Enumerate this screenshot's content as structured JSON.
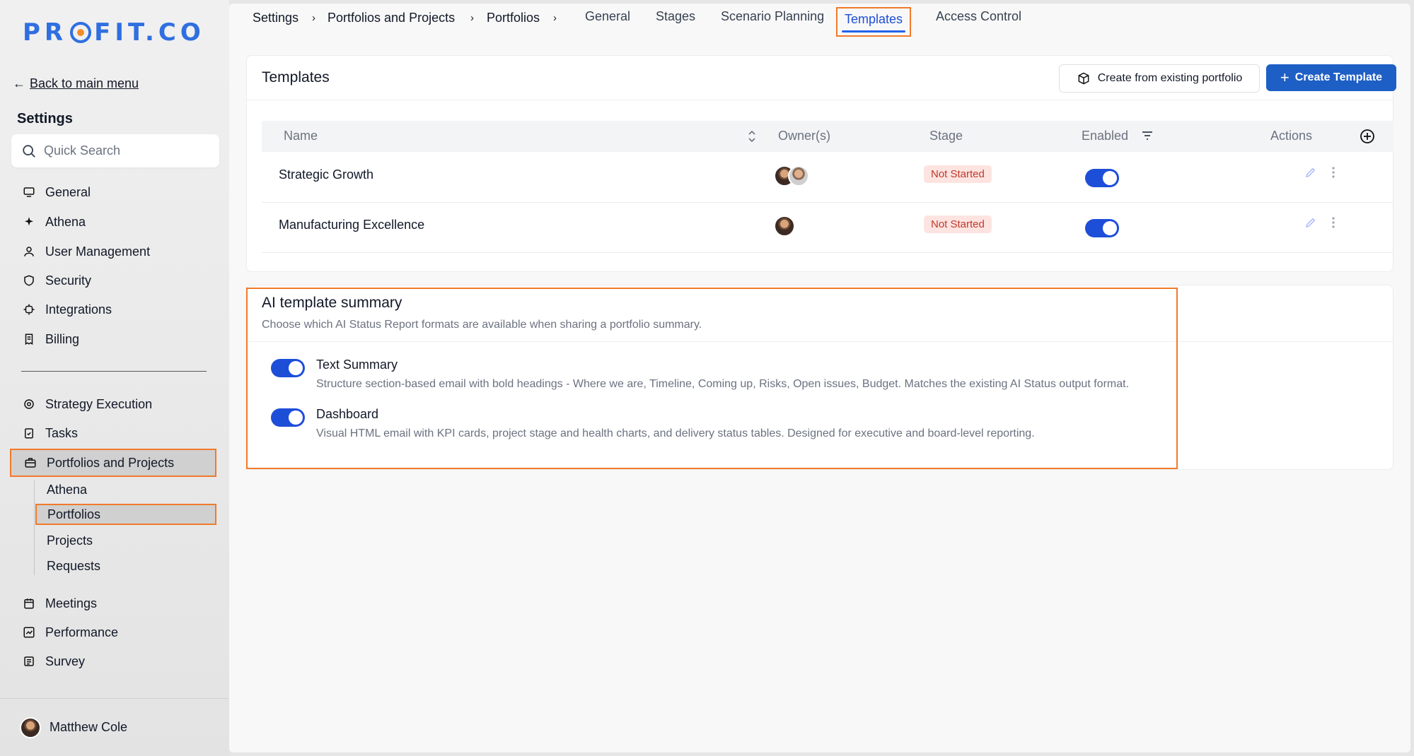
{
  "brand": {
    "logo": "PROFIT.CO",
    "accent": "#1e5fc5",
    "highlight": "#f07a2c"
  },
  "sidebar": {
    "back_label": "Back to main menu",
    "settings_title": "Settings",
    "search_placeholder": "Quick Search",
    "items_top": [
      {
        "label": "General",
        "icon": "monitor-icon"
      },
      {
        "label": "Athena",
        "icon": "sparkle-icon"
      },
      {
        "label": "User Management",
        "icon": "user-icon"
      },
      {
        "label": "Security",
        "icon": "shield-icon"
      },
      {
        "label": "Integrations",
        "icon": "plug-icon"
      },
      {
        "label": "Billing",
        "icon": "receipt-icon"
      }
    ],
    "items_bottom": [
      {
        "label": "Strategy Execution",
        "icon": "target-icon"
      },
      {
        "label": "Tasks",
        "icon": "clipboard-check-icon"
      },
      {
        "label": "Portfolios and Projects",
        "icon": "briefcase-icon"
      }
    ],
    "sub_items": [
      "Athena",
      "Portfolios",
      "Projects",
      "Requests"
    ],
    "items_more": [
      {
        "label": "Meetings",
        "icon": "calendar-icon"
      },
      {
        "label": "Performance",
        "icon": "chart-line-icon"
      },
      {
        "label": "Survey",
        "icon": "survey-icon"
      }
    ],
    "user_name": "Matthew Cole"
  },
  "topnav": {
    "breadcrumb": [
      "Settings",
      "Portfolios and Projects",
      "Portfolios"
    ],
    "tabs": [
      "General",
      "Stages",
      "Scenario Planning",
      "Templates",
      "Access Control"
    ],
    "active_tab": "Templates"
  },
  "templates": {
    "title": "Templates",
    "create_existing_label": "Create from existing portfolio",
    "create_template_label": "Create Template",
    "columns": [
      "Name",
      "Owner(s)",
      "Stage",
      "Enabled",
      "Actions"
    ],
    "rows": [
      {
        "name": "Strategic Growth",
        "owners": 2,
        "stage": "Not Started",
        "enabled": true
      },
      {
        "name": "Manufacturing Excellence",
        "owners": 1,
        "stage": "Not Started",
        "enabled": true
      }
    ]
  },
  "ai_summary": {
    "title": "AI template summary",
    "subtitle": "Choose which AI Status Report formats are available when sharing a portfolio summary.",
    "options": [
      {
        "title": "Text Summary",
        "enabled": true,
        "description": "Structure section-based email with bold headings - Where we are, Timeline, Coming up, Risks, Open issues, Budget. Matches the existing AI Status output format."
      },
      {
        "title": "Dashboard",
        "enabled": true,
        "description": "Visual HTML email with KPI cards, project stage and health charts, and delivery status tables. Designed for executive and board-level reporting."
      }
    ]
  }
}
